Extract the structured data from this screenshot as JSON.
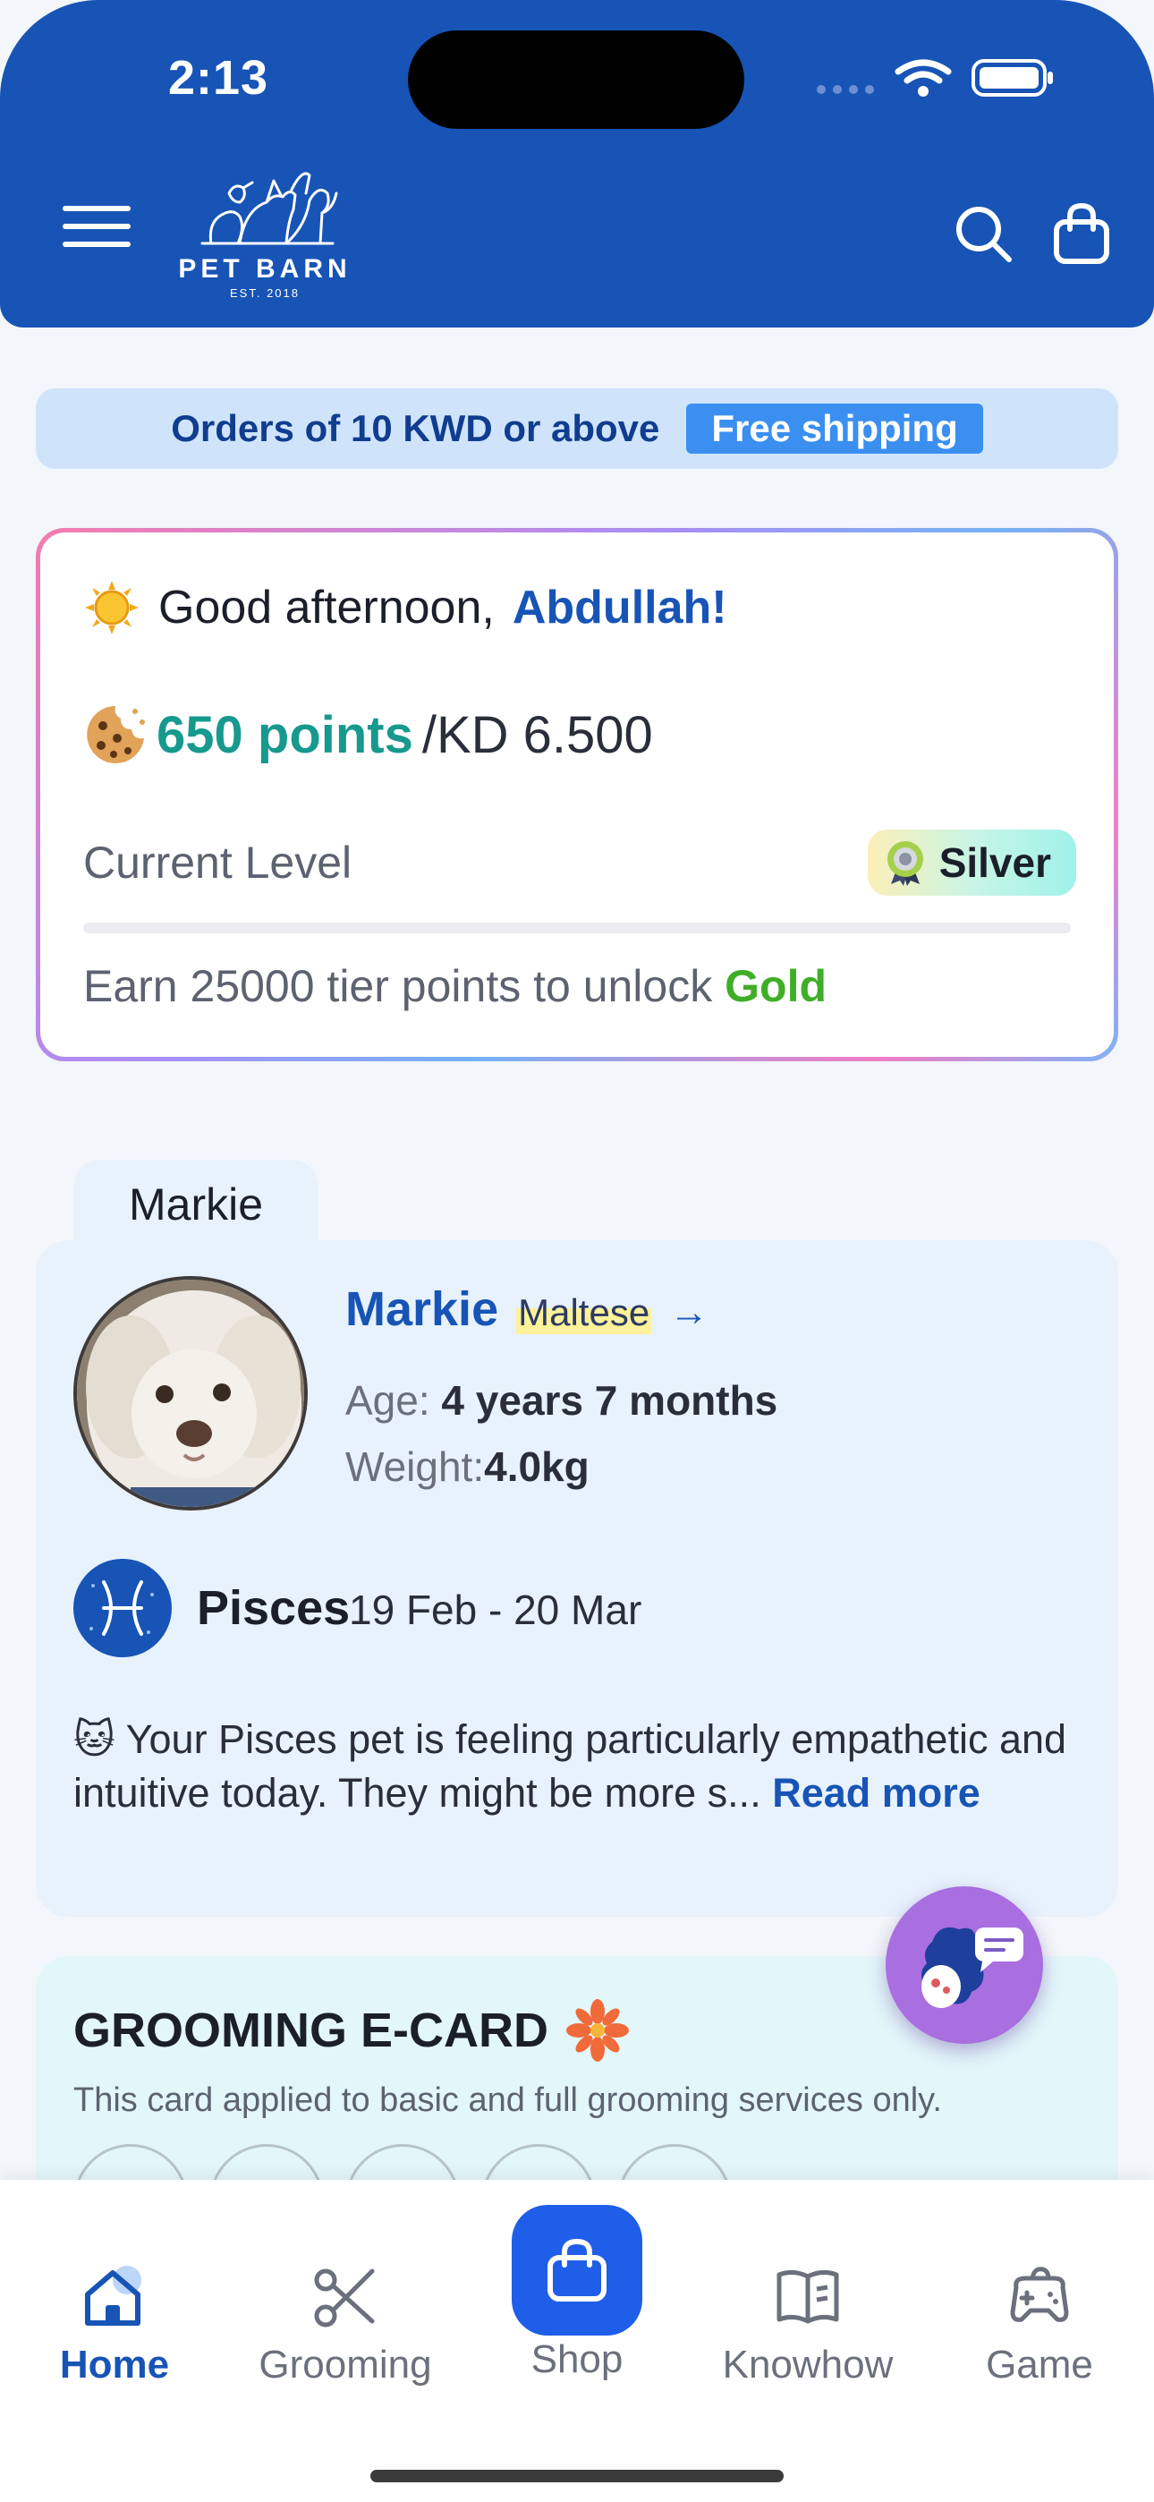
{
  "status": {
    "time": "2:13"
  },
  "header": {
    "brand": "PET BARN",
    "brand_est": "EST. 2018",
    "icons": {
      "menu": "hamburger-icon",
      "search": "search-icon",
      "bag": "shopping-bag-icon"
    }
  },
  "shipping_banner": {
    "text": "Orders of 10 KWD or above",
    "badge": "Free shipping"
  },
  "loyalty": {
    "greeting": "Good afternoon,",
    "name": "Abdullah!",
    "points": "650 points",
    "points_value": "/KD 6.500",
    "level_label": "Current Level",
    "level": "Silver",
    "progress_fraction": 0.0,
    "unlock_text": "Earn 25000 tier points to unlock",
    "next_tier": "Gold",
    "colors": {
      "points": "#17998e",
      "next_tier": "#3fae27",
      "name": "#1754b6"
    }
  },
  "pet": {
    "tab": "Markie",
    "name": "Markie",
    "breed": "Maltese",
    "arrow": "→",
    "age_label": "Age:",
    "age": "4 years 7 months",
    "weight_label": "Weight:",
    "weight": "4.0kg",
    "zodiac": "Pisces",
    "zodiac_dates": "19 Feb - 20 Mar",
    "horoscope_emoji": "🐱",
    "horoscope": "Your Pisces pet is feeling particularly empathetic and intuitive today. They might be more s...",
    "read_more": "Read more"
  },
  "grooming": {
    "title": "GROOMING E-CARD",
    "subtitle": "This card applied to basic and full grooming services only."
  },
  "nav": {
    "home": "Home",
    "grooming": "Grooming",
    "shop": "Shop",
    "knowhow": "Knowhow",
    "game": "Game",
    "active": "Home"
  }
}
